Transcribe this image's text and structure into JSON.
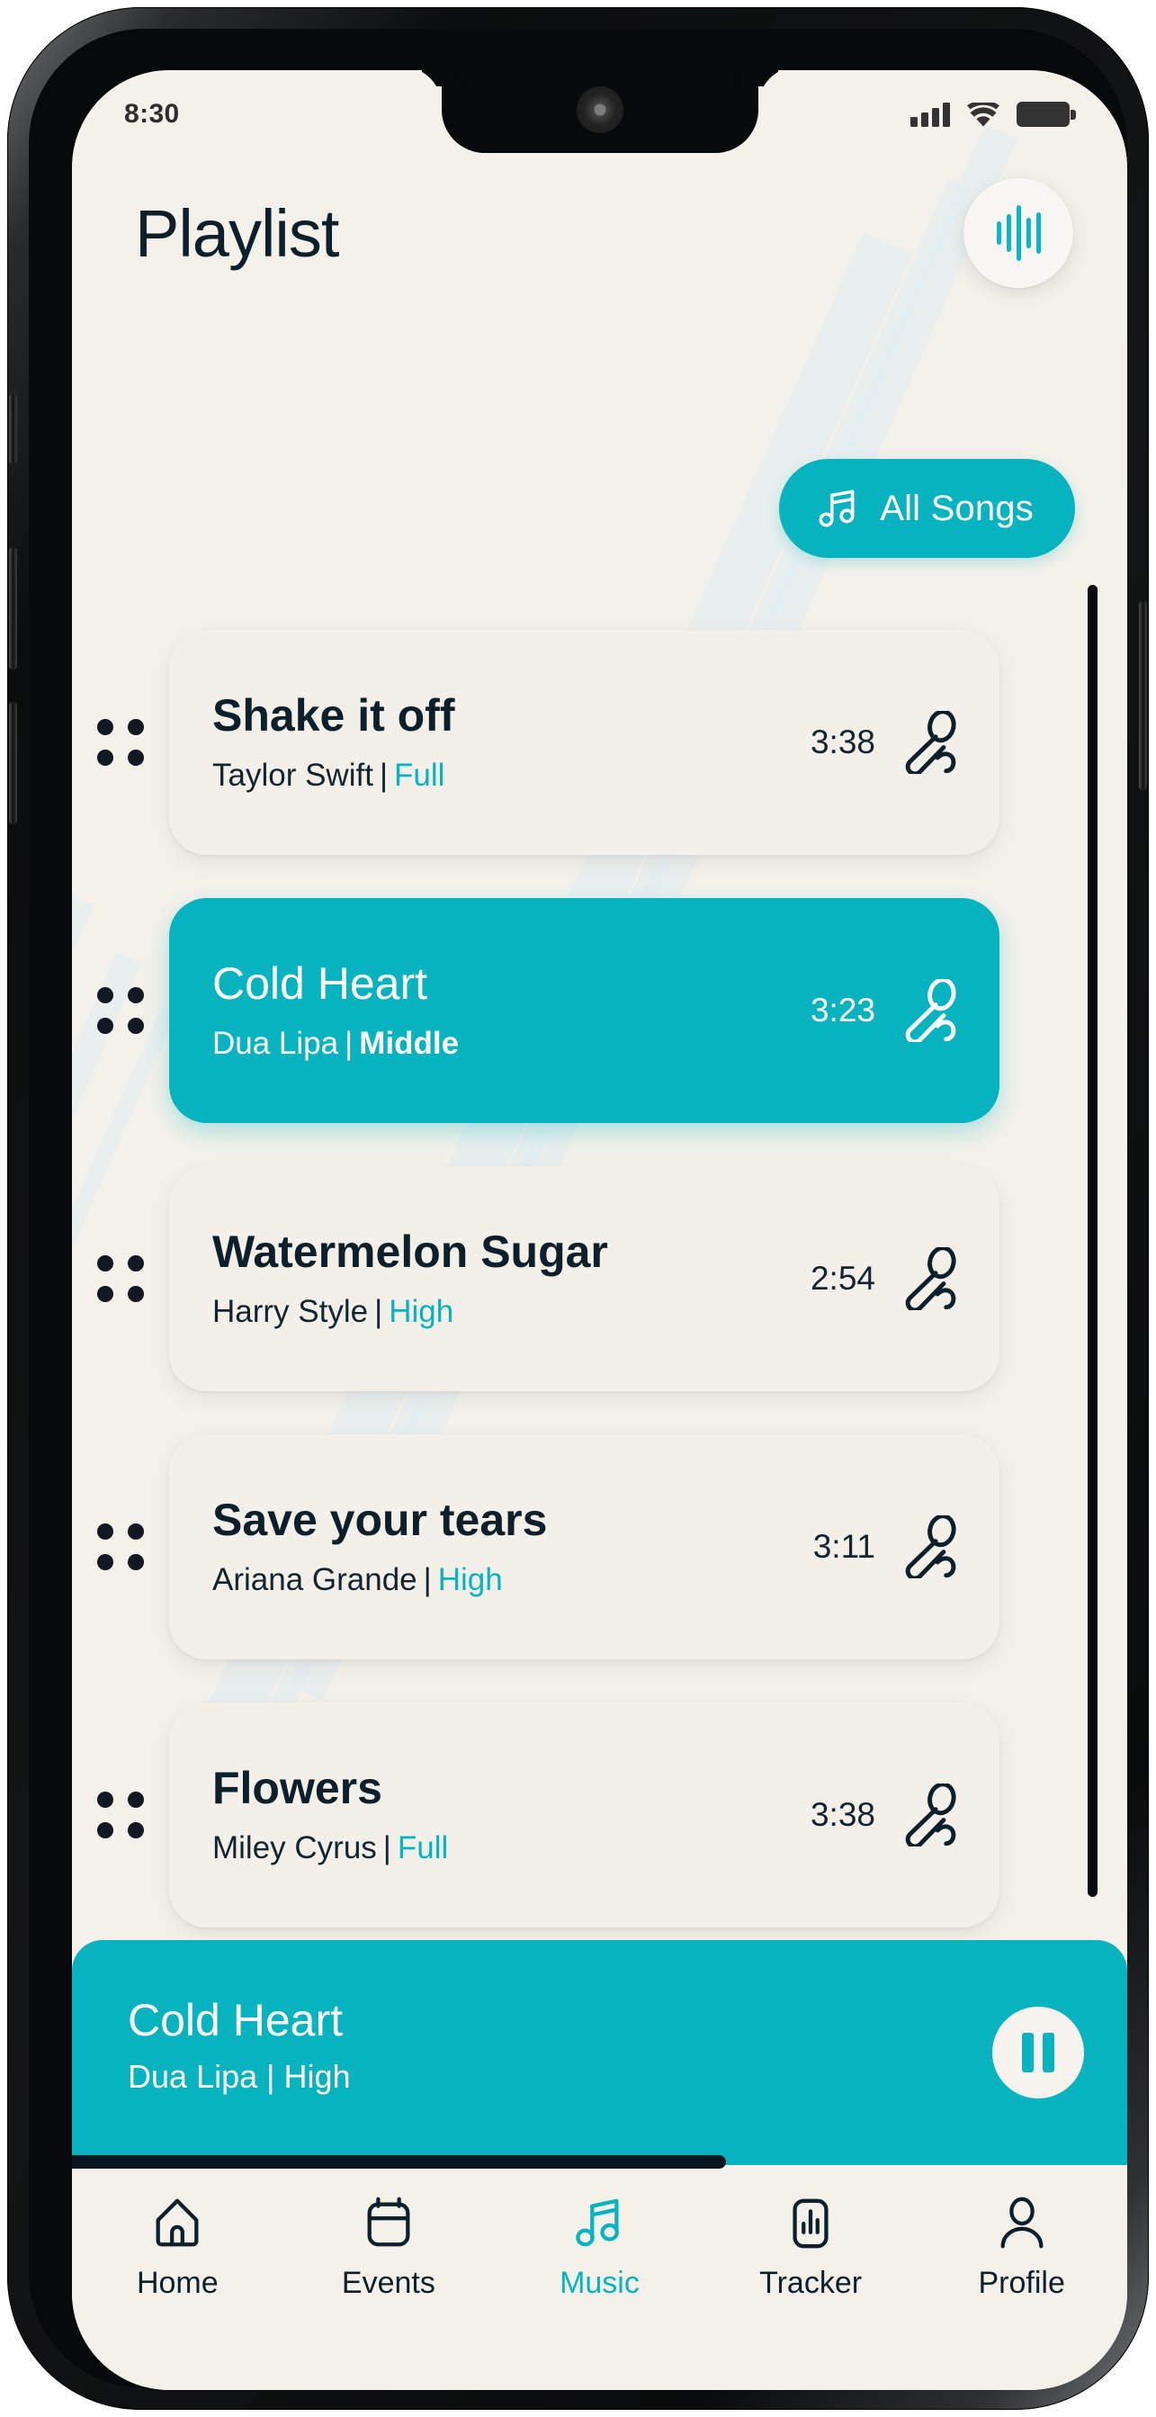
{
  "status_bar": {
    "time": "8:30",
    "icons": [
      "signal-bars-icon",
      "wifi-icon",
      "battery-icon"
    ]
  },
  "header": {
    "title": "Playlist",
    "wave_button_icon": "audio-wave-icon"
  },
  "filter": {
    "label": "All Songs",
    "icon": "music-note-icon"
  },
  "songs": [
    {
      "title": "Shake it off",
      "artist": "Taylor Swift",
      "sep": "|",
      "tag": "Full",
      "duration": "3:38",
      "active": false
    },
    {
      "title": "Cold Heart",
      "artist": "Dua Lipa",
      "sep": "|",
      "tag": "Middle",
      "duration": "3:23",
      "active": true
    },
    {
      "title": "Watermelon Sugar",
      "artist": "Harry Style",
      "sep": "|",
      "tag": "High",
      "duration": "2:54",
      "active": false
    },
    {
      "title": "Save your tears",
      "artist": "Ariana Grande",
      "sep": "|",
      "tag": "High",
      "duration": "3:11",
      "active": false
    },
    {
      "title": "Flowers",
      "artist": "Miley Cyrus",
      "sep": "|",
      "tag": "Full",
      "duration": "3:38",
      "active": false
    }
  ],
  "now_playing": {
    "title": "Cold Heart",
    "artist": "Dua Lipa",
    "sep": "|",
    "tag": "High",
    "progress_percent": 62,
    "control_icon": "pause-icon"
  },
  "bottom_nav": [
    {
      "label": "Home",
      "icon": "home-icon",
      "active": false
    },
    {
      "label": "Events",
      "icon": "calendar-icon",
      "active": false
    },
    {
      "label": "Music",
      "icon": "music-note-icon",
      "active": true
    },
    {
      "label": "Tracker",
      "icon": "chart-icon",
      "active": false
    },
    {
      "label": "Profile",
      "icon": "person-icon",
      "active": false
    }
  ],
  "colors": {
    "accent": "#06b3bf",
    "screen_bg": "#f4f1eb",
    "card_bg": "#f3f0ea",
    "text_dark": "#0c1f2b"
  }
}
